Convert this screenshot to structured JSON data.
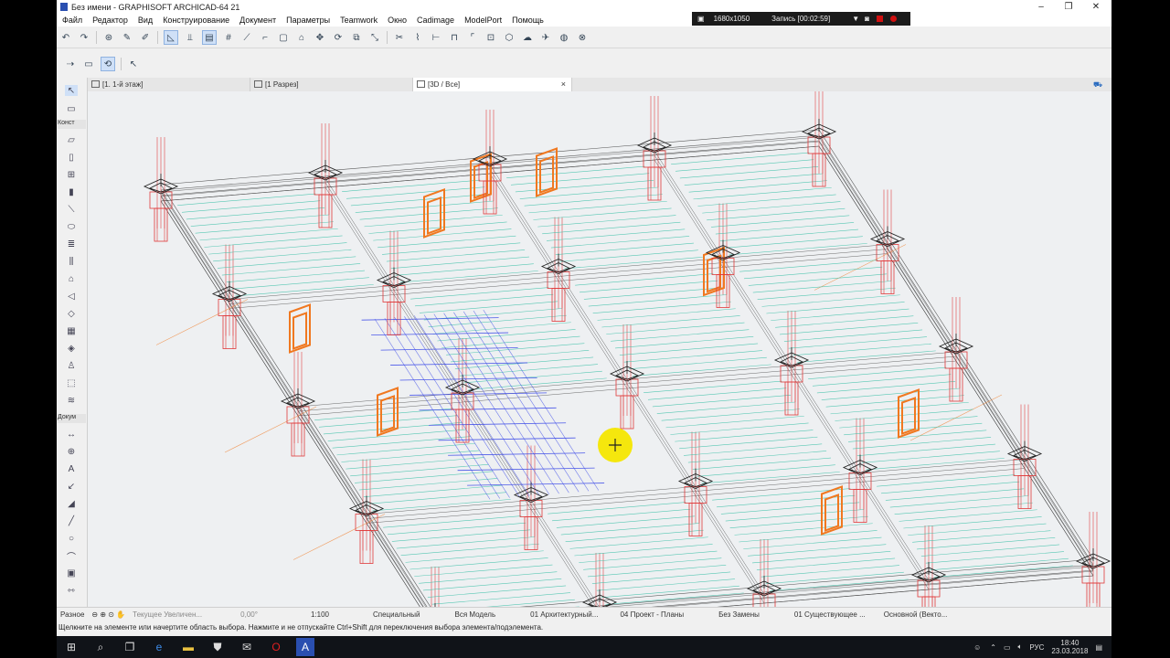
{
  "window": {
    "title": "Без имени - GRAPHISOFT ARCHICAD-64 21",
    "minimize": "–",
    "maximize": "❐",
    "close": "✕"
  },
  "menu": [
    "Файл",
    "Редактор",
    "Вид",
    "Конструирование",
    "Документ",
    "Параметры",
    "Teamwork",
    "Окно",
    "Cadimage",
    "ModelPort",
    "Помощь"
  ],
  "recorder": {
    "resolution": "1680x1050",
    "status": "Запись [00:02:59]"
  },
  "tabs": [
    {
      "label": "[1. 1-й этаж]"
    },
    {
      "label": "[1 Разрез]"
    },
    {
      "label": "[3D / Все]",
      "close": "×"
    }
  ],
  "toolbox": {
    "group_construct": "Конст",
    "group_document": "Докум"
  },
  "status_bar": {
    "left_label": "Разное",
    "zoom": "Текущее Увеличен...",
    "angle": "0,00°",
    "scale": "1:100",
    "layer_combo": "Специальный",
    "model_view": "Вся Модель",
    "pen_set": "01 Архитектурный...",
    "plan_view": "04 Проект - Планы",
    "override": "Без Замены",
    "renovation": "01 Существующее ...",
    "structure": "Основной (Векто..."
  },
  "hint": "Щелкните на элементе или начертите область выбора. Нажмите и не отпускайте Ctrl+Shift для переключения выбора элемента/подэлемента.",
  "clock": {
    "time": "18:40",
    "date": "23.03.2018",
    "lang": "РУС"
  },
  "colors": {
    "slab": "#3cc0a8",
    "column": "#e03a3a",
    "beam": "#3a48e8",
    "window": "#f07820",
    "wire": "#333333",
    "highlight": "#f4e600"
  }
}
